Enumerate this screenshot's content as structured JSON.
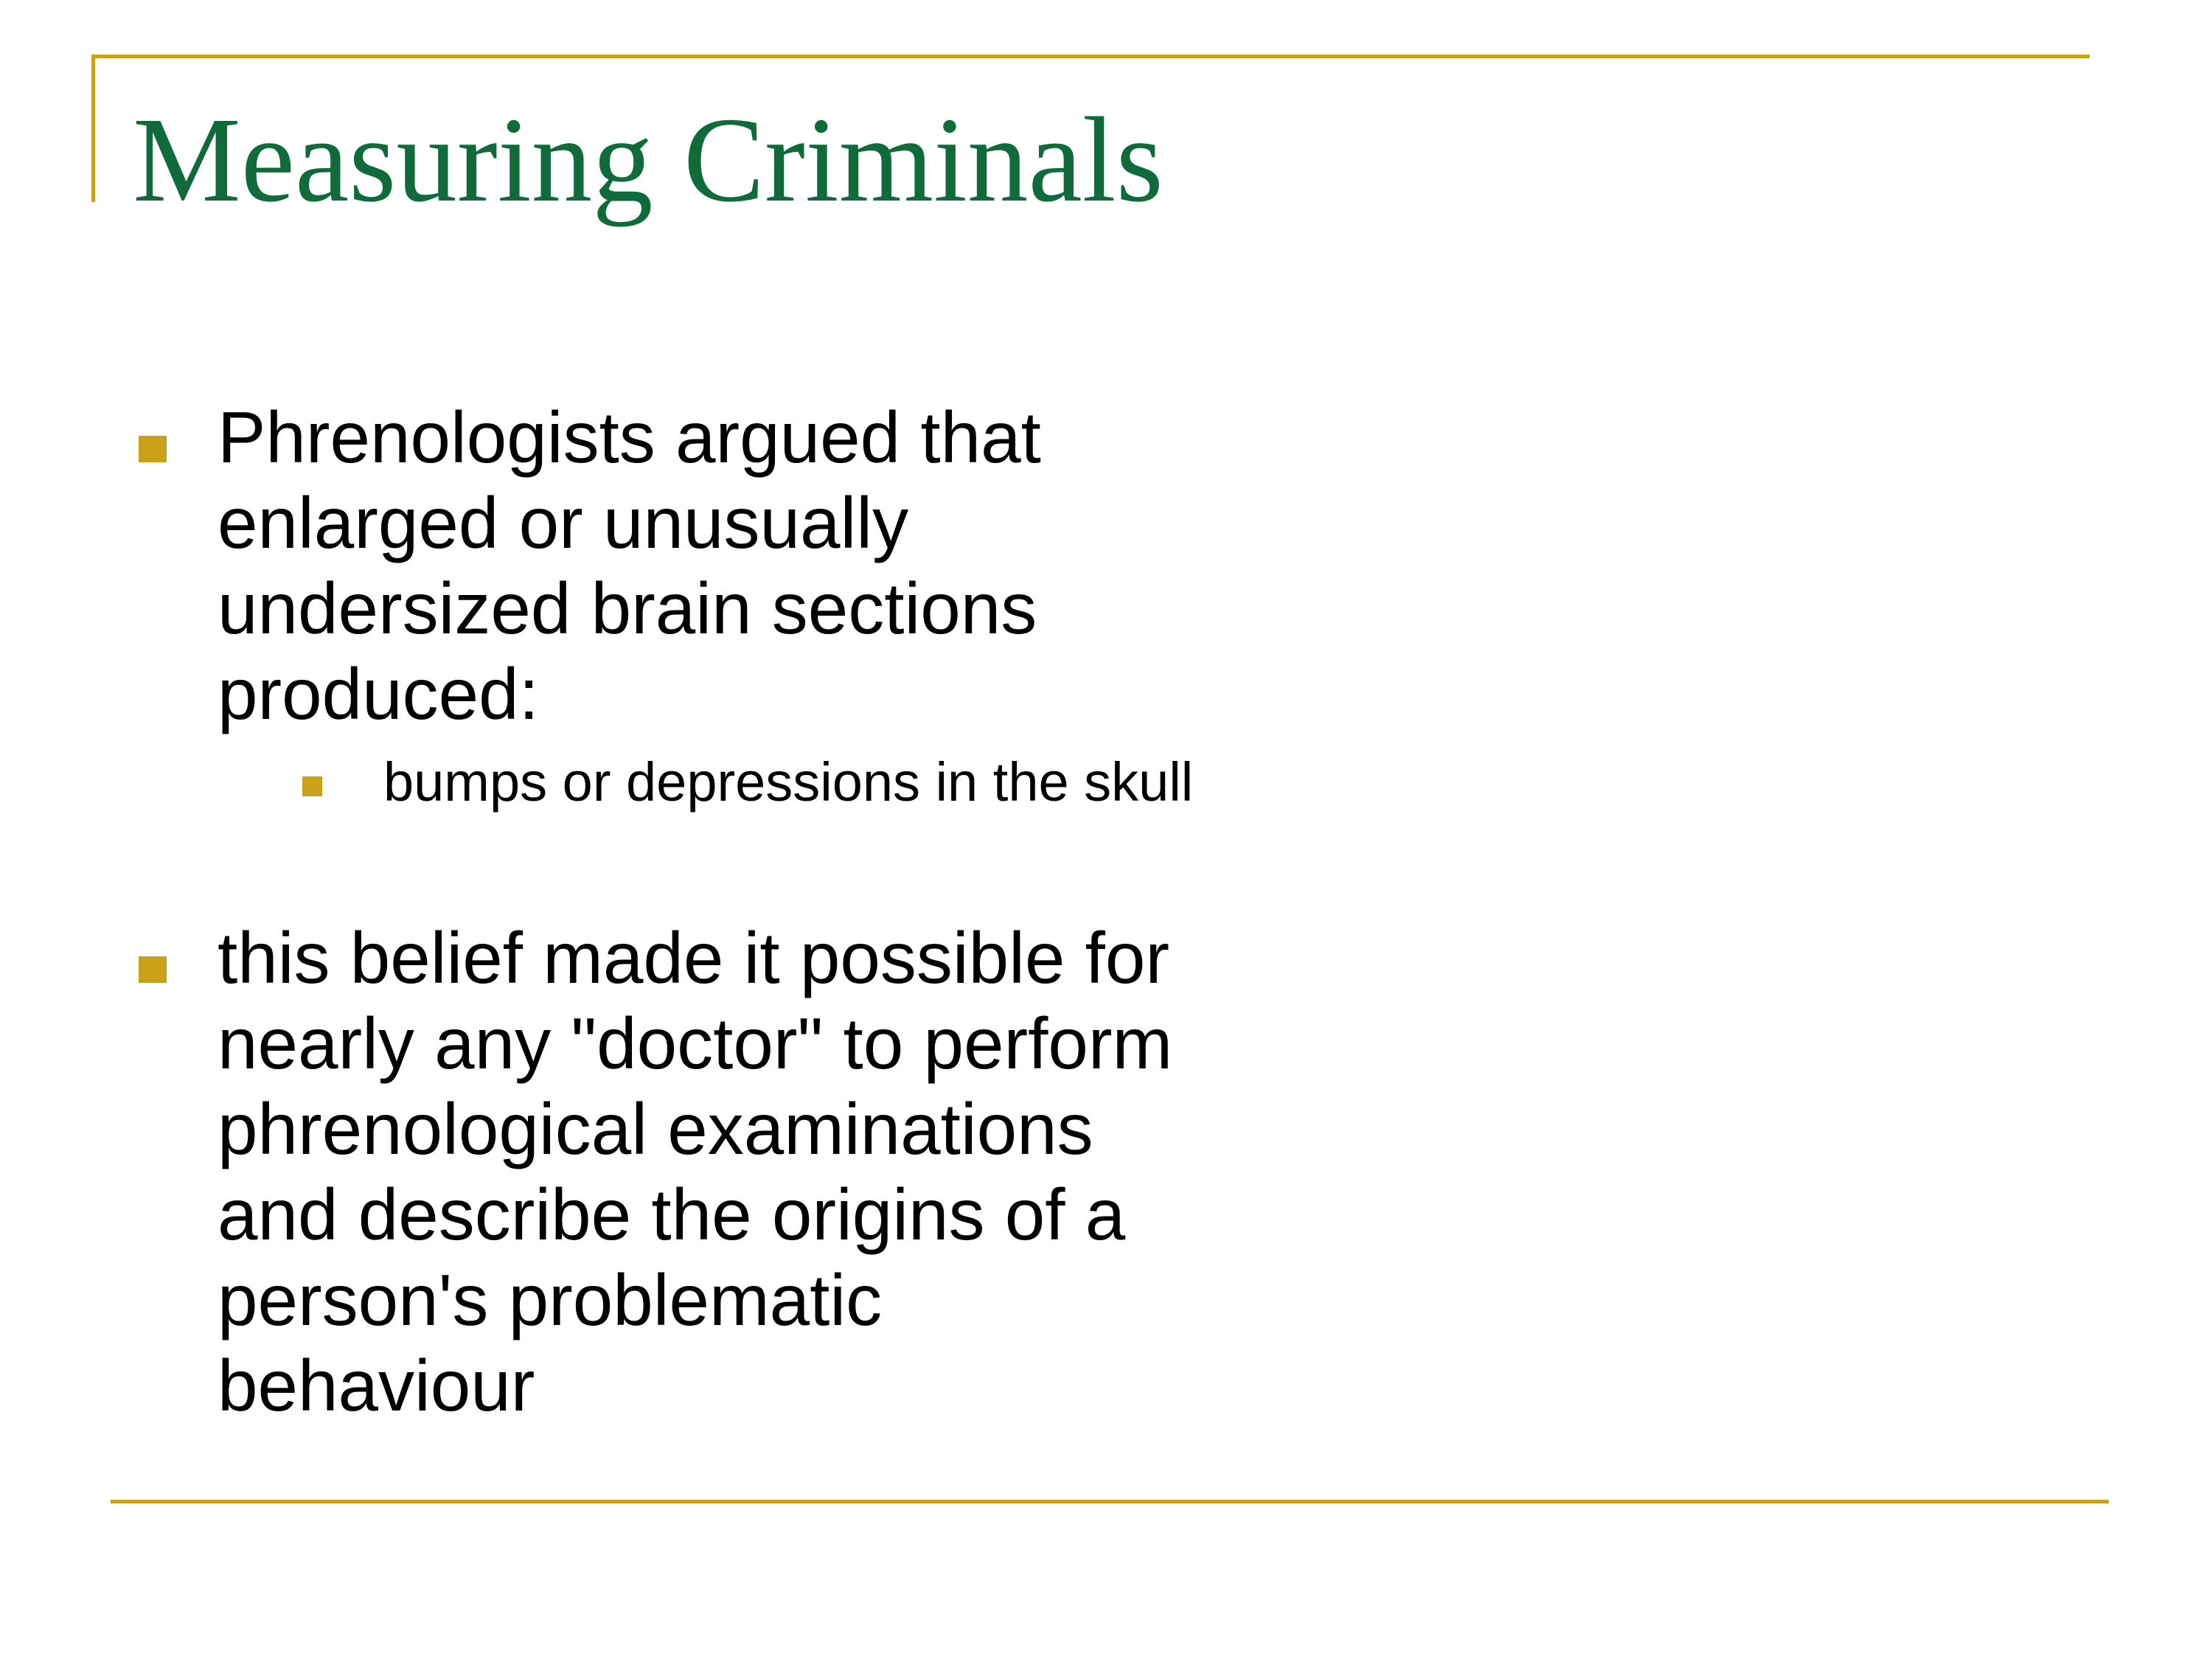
{
  "slide": {
    "title": "Measuring Criminals",
    "accent_color": "#c9a21a",
    "title_color": "#0f6b3a",
    "bullets": [
      {
        "lines": [
          "Phrenologists argued that",
          "enlarged or unusually",
          "undersized brain sections",
          "produced:"
        ],
        "sub_bullets": [
          {
            "text": "bumps or depressions in the skull"
          }
        ]
      },
      {
        "lines": [
          "this belief made it possible for",
          "nearly any \"doctor\" to perform",
          "phrenological examinations",
          "and describe the origins of a",
          "person's problematic",
          "behaviour"
        ],
        "sub_bullets": []
      }
    ]
  }
}
